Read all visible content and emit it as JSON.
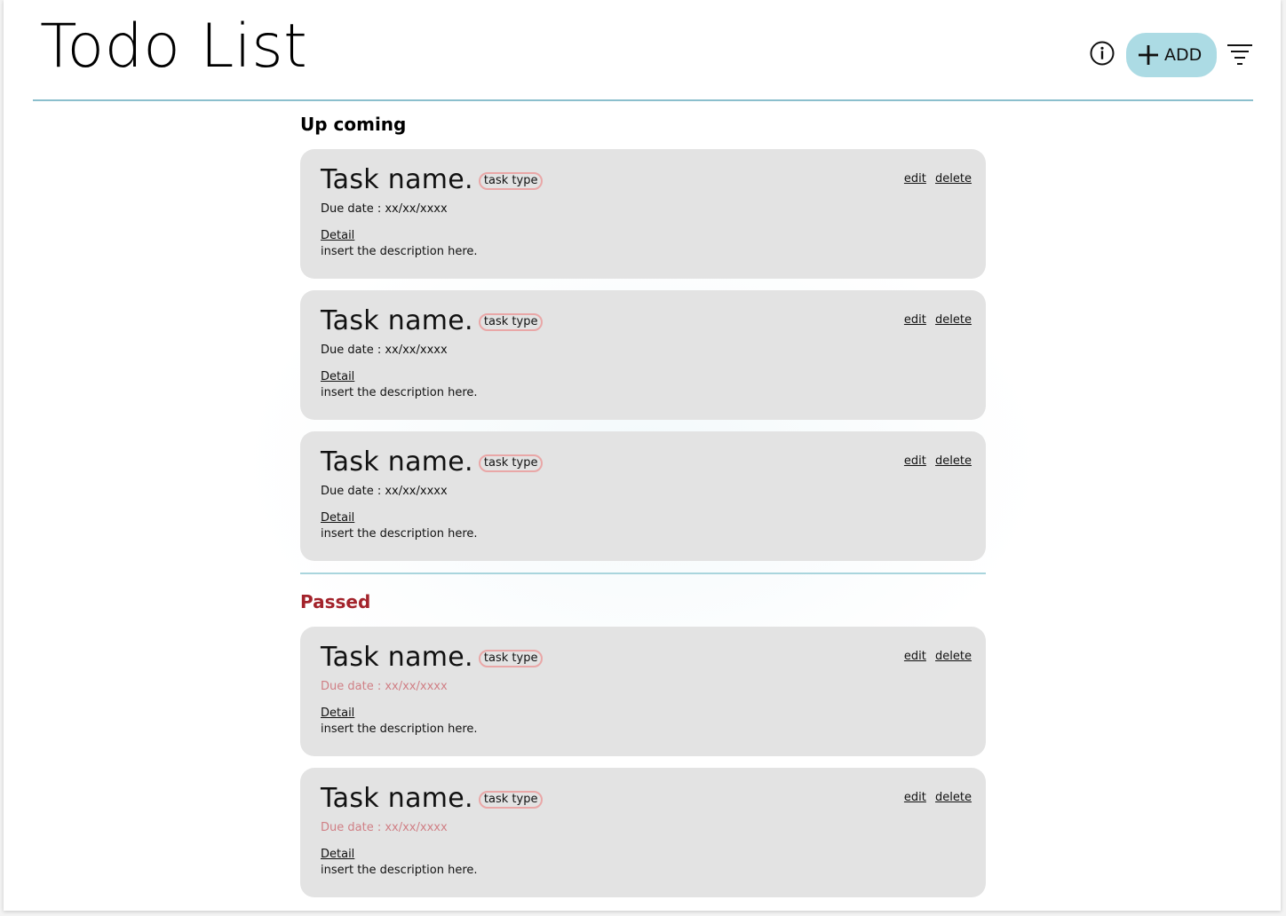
{
  "header": {
    "title": "Todo List",
    "add_label": "ADD"
  },
  "sections": {
    "upcoming": {
      "title": "Up coming",
      "tasks": [
        {
          "name": "Task name.",
          "type": "task type",
          "due": "Due date : xx/xx/xxxx",
          "detail_label": "Detail",
          "description": "insert the description here.",
          "edit": "edit",
          "delete": "delete"
        },
        {
          "name": "Task name.",
          "type": "task type",
          "due": "Due date : xx/xx/xxxx",
          "detail_label": "Detail",
          "description": "insert the description here.",
          "edit": "edit",
          "delete": "delete"
        },
        {
          "name": "Task name.",
          "type": "task type",
          "due": "Due date : xx/xx/xxxx",
          "detail_label": "Detail",
          "description": "insert the description here.",
          "edit": "edit",
          "delete": "delete"
        }
      ]
    },
    "passed": {
      "title": "Passed",
      "tasks": [
        {
          "name": "Task name.",
          "type": "task type",
          "due": "Due date : xx/xx/xxxx",
          "detail_label": "Detail",
          "description": "insert the description here.",
          "edit": "edit",
          "delete": "delete"
        },
        {
          "name": "Task name.",
          "type": "task type",
          "due": "Due date : xx/xx/xxxx",
          "detail_label": "Detail",
          "description": "insert the description here.",
          "edit": "edit",
          "delete": "delete"
        }
      ]
    }
  },
  "icons": {
    "info": "info-icon",
    "add": "plus-icon",
    "filter": "filter-icon"
  },
  "colors": {
    "accent": "#acdbe4",
    "header_rule": "#8bbfcd",
    "card_bg": "#e3e3e3",
    "task_type_border": "#e9a7a7",
    "passed_title": "#a3232b",
    "overdue_text": "#d07f85"
  }
}
